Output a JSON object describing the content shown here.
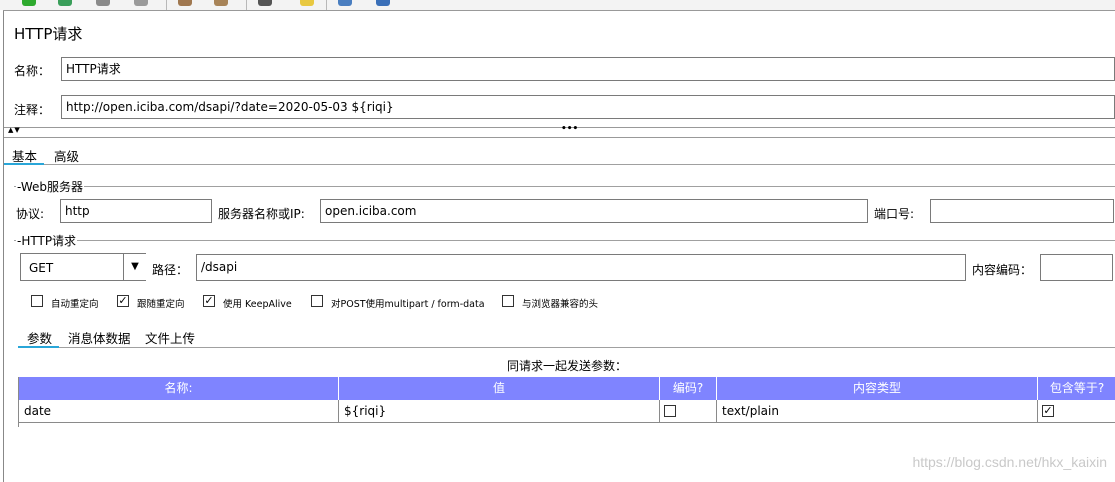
{
  "panel_title": "HTTP请求",
  "name_label": "名称：",
  "name_value": "HTTP请求",
  "comment_label": "注释：",
  "comment_value": "http://open.iciba.com/dsapi/?date=2020-05-03  ${riqi}",
  "splitter": {
    "collapse_glyph": "▲▼",
    "handle_glyph": "•••"
  },
  "main_tabs": [
    {
      "label": "基本",
      "selected": true
    },
    {
      "label": "高级",
      "selected": false
    }
  ],
  "web_server": {
    "title": "Web服务器",
    "protocol_label": "协议:",
    "protocol_value": "http",
    "server_label": "服务器名称或IP:",
    "server_value": "open.iciba.com",
    "port_label": "端口号:",
    "port_value": ""
  },
  "http_request": {
    "title": "HTTP请求",
    "method": "GET",
    "method_arrow": "▼",
    "path_label": "路径：",
    "path_value": "/dsapi",
    "encoding_label": "内容编码：",
    "encoding_value": ""
  },
  "options": [
    {
      "label": "自动重定向",
      "checked": false
    },
    {
      "label": "跟随重定向",
      "checked": true
    },
    {
      "label": "使用 KeepAlive",
      "checked": true
    },
    {
      "label": "对POST使用multipart / form-data",
      "checked": false
    },
    {
      "label": "与浏览器兼容的头",
      "checked": false
    }
  ],
  "sub_tabs": [
    {
      "label": "参数",
      "selected": true
    },
    {
      "label": "消息体数据",
      "selected": false
    },
    {
      "label": "文件上传",
      "selected": false
    }
  ],
  "params_caption": "同请求一起发送参数：",
  "params_table": {
    "columns": [
      "名称:",
      "值",
      "编码?",
      "内容类型",
      "包含等于?"
    ],
    "rows": [
      {
        "name": "date",
        "value": "${riqi}",
        "encode": false,
        "content_type": "text/plain",
        "include_equals": true
      }
    ]
  },
  "check_mark": "✓",
  "watermark": "https://blog.csdn.net/hkx_kaixin",
  "colors": {
    "header_bg": "#7f84ff",
    "tab_underline": "#29a6d8"
  }
}
